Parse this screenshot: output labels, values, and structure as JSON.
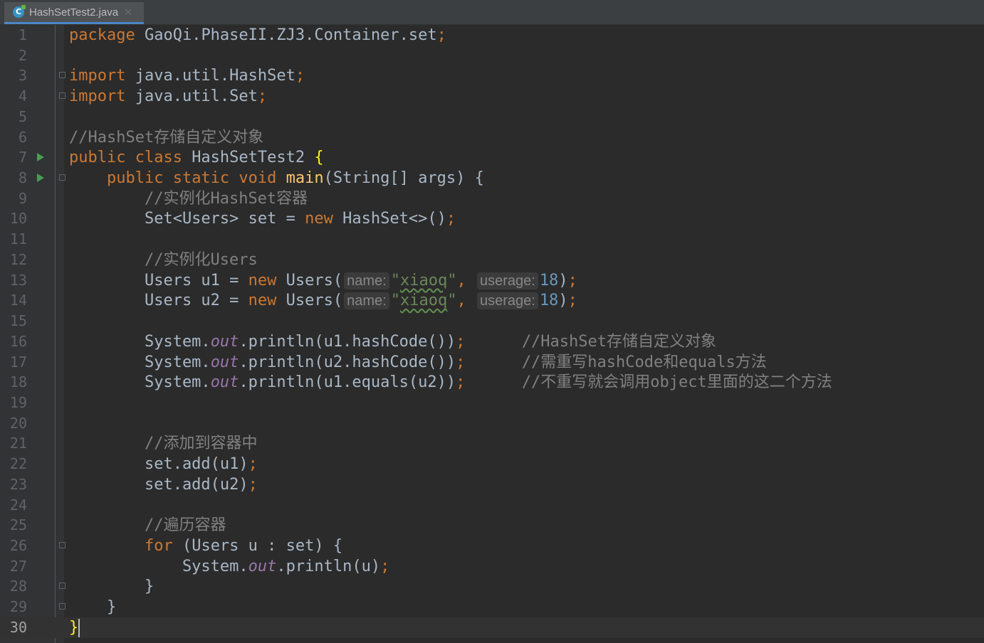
{
  "tab": {
    "filename": "HashSetTest2.java",
    "close": "×",
    "icon": "C"
  },
  "lines": [
    {
      "n": "1",
      "t": [
        [
          "k",
          "package "
        ],
        [
          "p",
          "GaoQi.PhaseII.ZJ3.Container.set"
        ],
        [
          "k",
          ";"
        ]
      ]
    },
    {
      "n": "2",
      "t": []
    },
    {
      "n": "3",
      "t": [
        [
          "k",
          "import "
        ],
        [
          "p",
          "java.util.HashSet"
        ],
        [
          "k",
          ";"
        ]
      ]
    },
    {
      "n": "4",
      "t": [
        [
          "k",
          "import "
        ],
        [
          "p",
          "java.util.Set"
        ],
        [
          "k",
          ";"
        ]
      ]
    },
    {
      "n": "5",
      "t": []
    },
    {
      "n": "6",
      "t": [
        [
          "c",
          "//HashSet存储自定义对象"
        ]
      ]
    },
    {
      "n": "7",
      "t": [
        [
          "k",
          "public class "
        ],
        [
          "p",
          "HashSetTest2 "
        ],
        [
          "b",
          "{"
        ]
      ]
    },
    {
      "n": "8",
      "t": [
        [
          "p",
          "    "
        ],
        [
          "k",
          "public static void "
        ],
        [
          "f",
          "main"
        ],
        [
          "p",
          "(String[] args) {"
        ]
      ]
    },
    {
      "n": "9",
      "t": [
        [
          "p",
          "        "
        ],
        [
          "c",
          "//实例化HashSet容器"
        ]
      ]
    },
    {
      "n": "10",
      "t": [
        [
          "p",
          "        Set<Users> set = "
        ],
        [
          "k",
          "new "
        ],
        [
          "p",
          "HashSet<>()"
        ],
        [
          "k",
          ";"
        ]
      ]
    },
    {
      "n": "11",
      "t": []
    },
    {
      "n": "12",
      "t": [
        [
          "p",
          "        "
        ],
        [
          "c",
          "//实例化Users"
        ]
      ]
    },
    {
      "n": "13",
      "t": [
        [
          "p",
          "        Users u1 = "
        ],
        [
          "k",
          "new "
        ],
        [
          "p",
          "Users("
        ],
        [
          "h",
          "name:"
        ],
        [
          "s",
          "\""
        ],
        [
          "sw",
          "xiaoq"
        ],
        [
          "s",
          "\""
        ],
        [
          "k",
          ", "
        ],
        [
          "h",
          "userage:"
        ],
        [
          "n",
          "18"
        ],
        [
          "p",
          ")"
        ],
        [
          "k",
          ";"
        ]
      ]
    },
    {
      "n": "14",
      "t": [
        [
          "p",
          "        Users u2 = "
        ],
        [
          "k",
          "new "
        ],
        [
          "p",
          "Users("
        ],
        [
          "h",
          "name:"
        ],
        [
          "s",
          "\""
        ],
        [
          "sw",
          "xiaoq"
        ],
        [
          "s",
          "\""
        ],
        [
          "k",
          ", "
        ],
        [
          "h",
          "userage:"
        ],
        [
          "n",
          "18"
        ],
        [
          "p",
          ")"
        ],
        [
          "k",
          ";"
        ]
      ]
    },
    {
      "n": "15",
      "t": []
    },
    {
      "n": "16",
      "t": [
        [
          "p",
          "        System."
        ],
        [
          "st",
          "out"
        ],
        [
          "p",
          ".println(u1.hashCode())"
        ],
        [
          "k",
          ";"
        ],
        [
          "p",
          "      "
        ],
        [
          "c",
          "//HashSet存储自定义对象"
        ]
      ]
    },
    {
      "n": "17",
      "t": [
        [
          "p",
          "        System."
        ],
        [
          "st",
          "out"
        ],
        [
          "p",
          ".println(u2.hashCode())"
        ],
        [
          "k",
          ";"
        ],
        [
          "p",
          "      "
        ],
        [
          "c",
          "//需重写hashCode和equals方法"
        ]
      ]
    },
    {
      "n": "18",
      "t": [
        [
          "p",
          "        System."
        ],
        [
          "st",
          "out"
        ],
        [
          "p",
          ".println(u1.equals(u2))"
        ],
        [
          "k",
          ";"
        ],
        [
          "p",
          "      "
        ],
        [
          "c",
          "//不重写就会调用object里面的这二个方法"
        ]
      ]
    },
    {
      "n": "19",
      "t": []
    },
    {
      "n": "20",
      "t": []
    },
    {
      "n": "21",
      "t": [
        [
          "p",
          "        "
        ],
        [
          "c",
          "//添加到容器中"
        ]
      ]
    },
    {
      "n": "22",
      "t": [
        [
          "p",
          "        set.add(u1)"
        ],
        [
          "k",
          ";"
        ]
      ]
    },
    {
      "n": "23",
      "t": [
        [
          "p",
          "        set.add(u2)"
        ],
        [
          "k",
          ";"
        ]
      ]
    },
    {
      "n": "24",
      "t": []
    },
    {
      "n": "25",
      "t": [
        [
          "p",
          "        "
        ],
        [
          "c",
          "//遍历容器"
        ]
      ]
    },
    {
      "n": "26",
      "t": [
        [
          "p",
          "        "
        ],
        [
          "k",
          "for "
        ],
        [
          "p",
          "(Users u : set) {"
        ]
      ]
    },
    {
      "n": "27",
      "t": [
        [
          "p",
          "            System."
        ],
        [
          "st",
          "out"
        ],
        [
          "p",
          ".println(u)"
        ],
        [
          "k",
          ";"
        ]
      ]
    },
    {
      "n": "28",
      "t": [
        [
          "p",
          "        }"
        ]
      ]
    },
    {
      "n": "29",
      "t": [
        [
          "p",
          "    }"
        ]
      ]
    },
    {
      "n": "30",
      "t": [
        [
          "b",
          "}"
        ],
        [
          "cur",
          ""
        ]
      ]
    }
  ],
  "current_line": "30",
  "run_lines": [
    "7",
    "8"
  ],
  "fold_lines": [
    "3",
    "4",
    "8",
    "26",
    "28",
    "29"
  ]
}
